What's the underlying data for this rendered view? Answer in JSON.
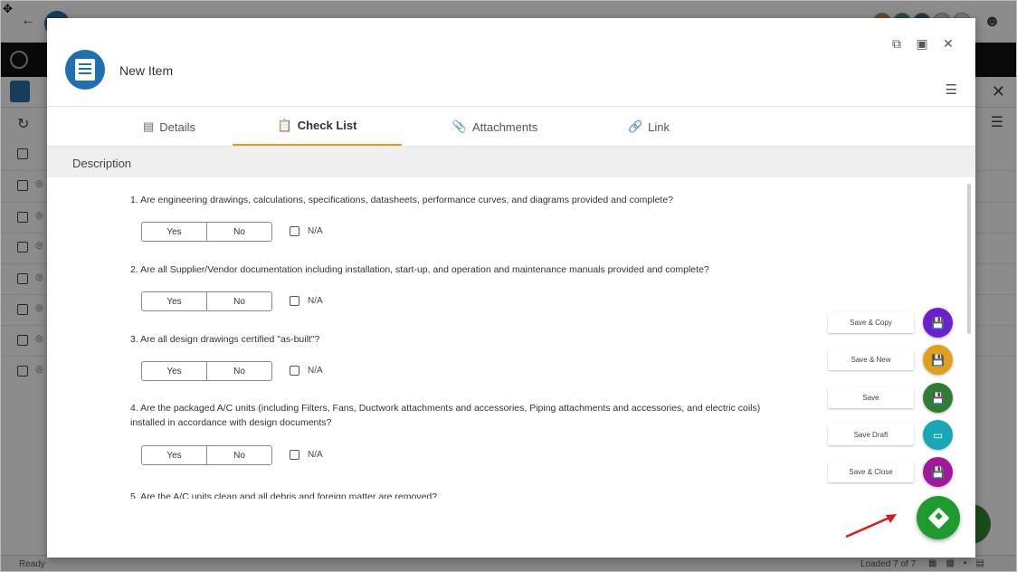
{
  "modal": {
    "title": "New Item",
    "tabs": [
      {
        "label": "Details",
        "icon": "details-icon"
      },
      {
        "label": "Check List",
        "icon": "clipboard-icon"
      },
      {
        "label": "Attachments",
        "icon": "paperclip-icon"
      },
      {
        "label": "Link",
        "icon": "link-icon"
      }
    ],
    "active_tab": "Check List",
    "section_header": "Description",
    "questions": [
      {
        "text": "1. Are engineering drawings, calculations, specifications, datasheets, performance curves, and diagrams provided and complete?",
        "yes": "Yes",
        "no": "No",
        "na": "N/A"
      },
      {
        "text": "2. Are all Supplier/Vendor documentation including installation, start-up, and operation and maintenance manuals provided and complete?",
        "yes": "Yes",
        "no": "No",
        "na": "N/A"
      },
      {
        "text": "3. Are all design drawings certified \"as-built\"?",
        "yes": "Yes",
        "no": "No",
        "na": "N/A"
      },
      {
        "text": "4. Are the packaged A/C units (including Filters, Fans, Ductwork attachments and accessories, Piping attachments and accessories, and electric coils) installed in accordance with design documents?",
        "yes": "Yes",
        "no": "No",
        "na": "N/A"
      },
      {
        "text": "5. Are the A/C units clean and all debris and foreign matter are removed?"
      }
    ]
  },
  "speed_dial": {
    "actions": [
      {
        "label": "Save & Copy",
        "color": "#6a1fd1",
        "icon": "save-copy-icon"
      },
      {
        "label": "Save & New",
        "color": "#e0a11a",
        "icon": "save-new-icon"
      },
      {
        "label": "Save",
        "color": "#2f7d32",
        "icon": "save-icon"
      },
      {
        "label": "Save Draft",
        "color": "#18a7b5",
        "icon": "save-draft-icon"
      },
      {
        "label": "Save & Close",
        "color": "#a3179e",
        "icon": "save-close-icon"
      }
    ],
    "main_color": "#1f9a2f"
  },
  "statusbar": {
    "status": "Ready",
    "loaded": "Loaded 7 of 7"
  }
}
